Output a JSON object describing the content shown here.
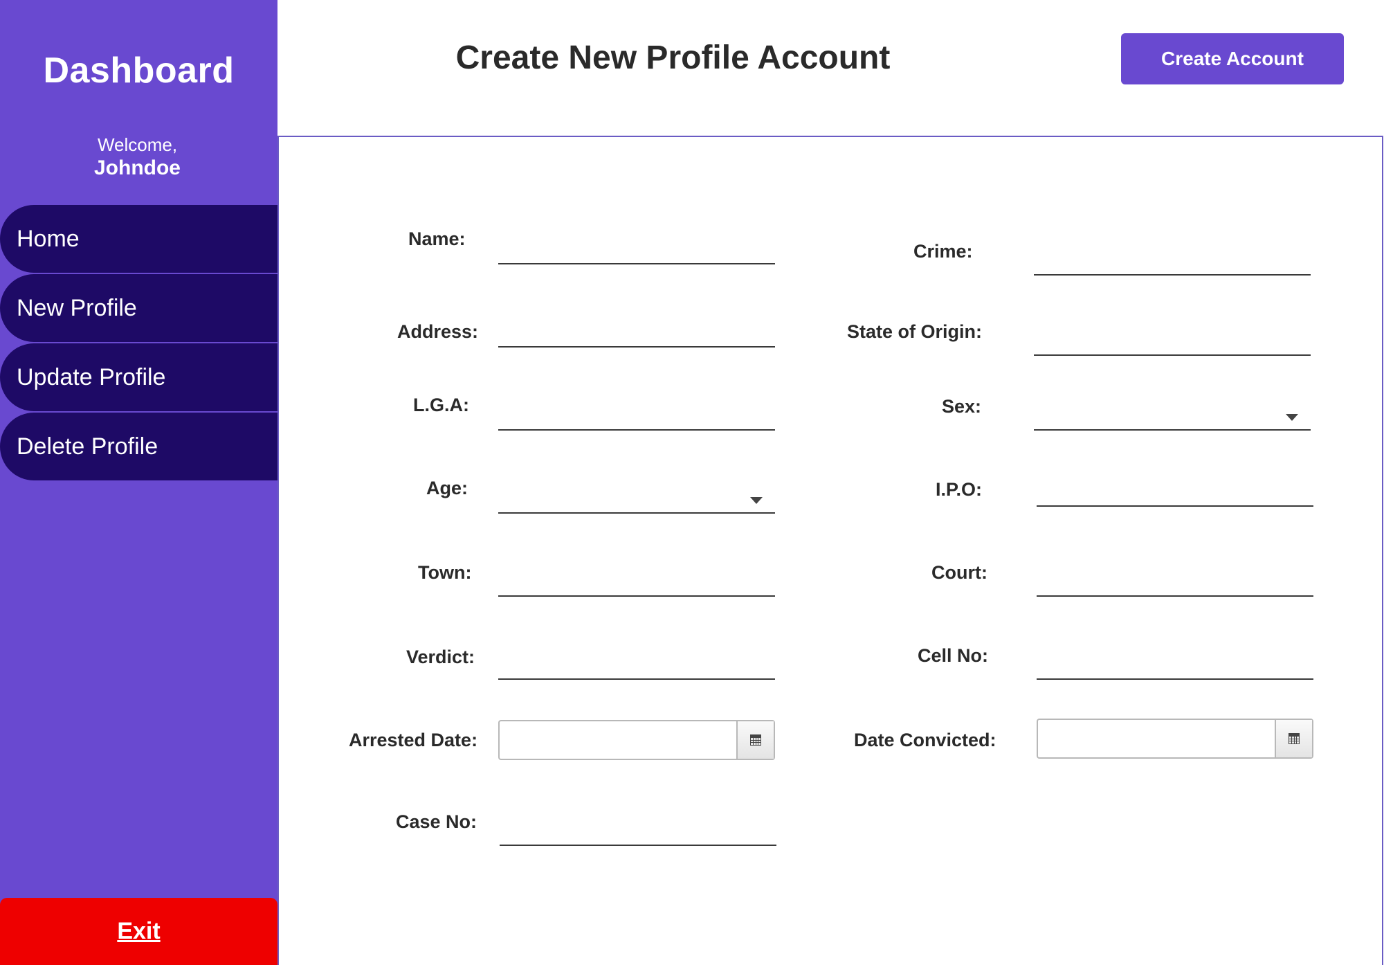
{
  "sidebar": {
    "title": "Dashboard",
    "welcome": "Welcome,",
    "username": "Johndoe",
    "nav": [
      {
        "label": "Home"
      },
      {
        "label": "New Profile"
      },
      {
        "label": "Update Profile"
      },
      {
        "label": "Delete Profile"
      }
    ],
    "exit_label": "Exit"
  },
  "header": {
    "title": "Create New Profile Account",
    "create_button": "Create Account"
  },
  "form": {
    "name": {
      "label": "Name:",
      "value": ""
    },
    "crime": {
      "label": "Crime:",
      "value": ""
    },
    "address": {
      "label": "Address:",
      "value": ""
    },
    "state_of_origin": {
      "label": "State of Origin:",
      "value": ""
    },
    "lga": {
      "label": "L.G.A:",
      "value": ""
    },
    "sex": {
      "label": "Sex:",
      "value": ""
    },
    "age": {
      "label": "Age:",
      "value": ""
    },
    "ipo": {
      "label": "I.P.O:",
      "value": ""
    },
    "town": {
      "label": "Town:",
      "value": ""
    },
    "court": {
      "label": "Court:",
      "value": ""
    },
    "verdict": {
      "label": "Verdict:",
      "value": ""
    },
    "cell_no": {
      "label": "Cell No:",
      "value": ""
    },
    "arrested_date": {
      "label": "Arrested Date:",
      "value": ""
    },
    "date_convicted": {
      "label": "Date Convicted:",
      "value": ""
    },
    "case_no": {
      "label": "Case No:",
      "value": ""
    }
  },
  "colors": {
    "sidebar_bg": "#6949d0",
    "nav_bg": "#1e0a66",
    "exit_bg": "#ee0000",
    "accent": "#6949d0"
  },
  "icons": {
    "dropdown": "chevron-down-icon",
    "calendar": "calendar-icon"
  }
}
